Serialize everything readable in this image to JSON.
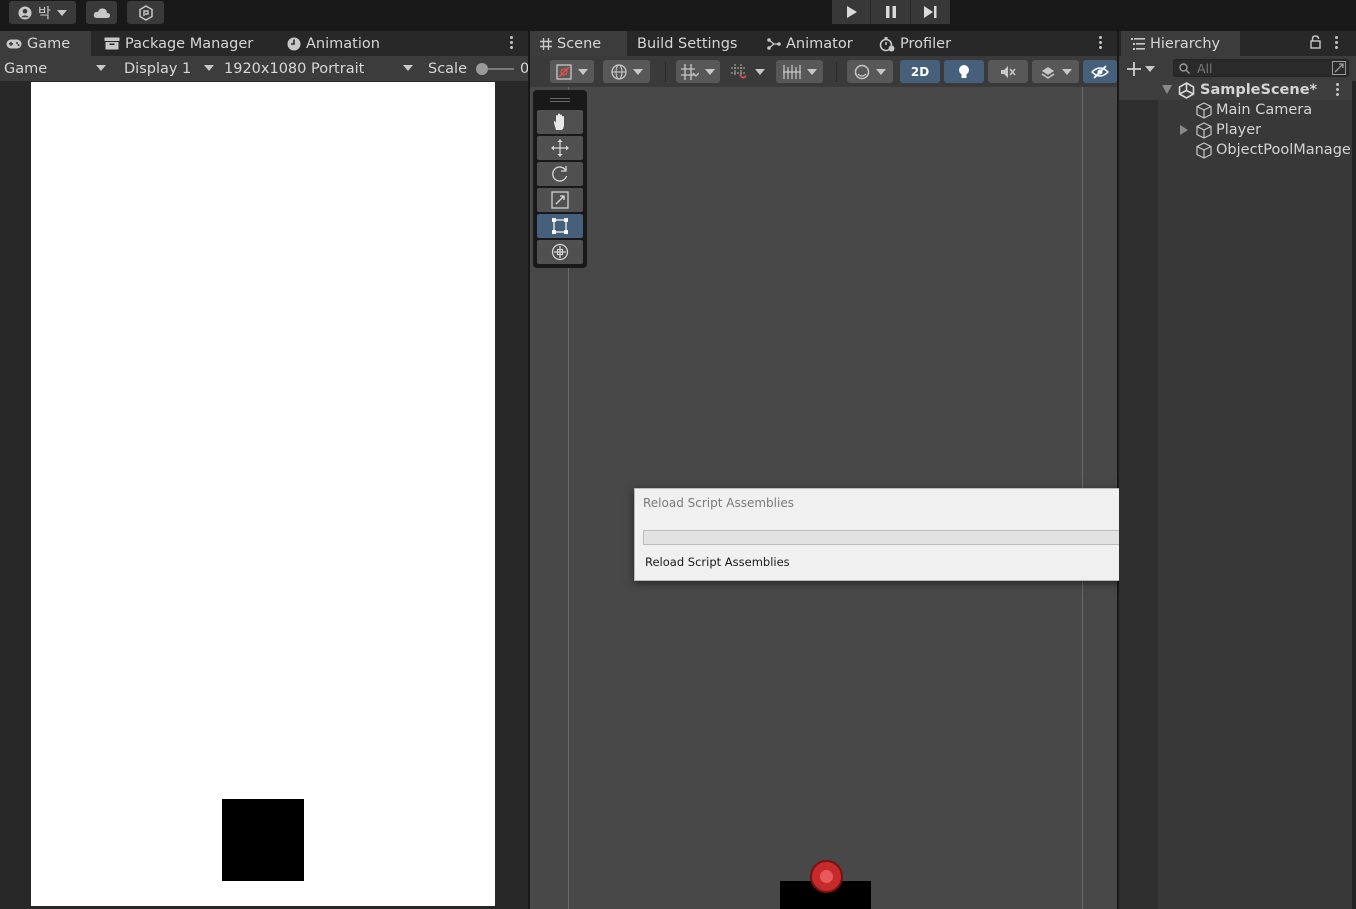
{
  "topbar": {
    "account_label": "박",
    "account_icon": "user-circle-icon",
    "cloud_icon": "cloud-icon",
    "collab_icon": "collab-icon",
    "play_icon": "play-icon",
    "pause_icon": "pause-icon",
    "step_icon": "step-icon"
  },
  "left_tabs": {
    "game": "Game",
    "package_manager": "Package Manager",
    "animation": "Animation"
  },
  "game_toolbar": {
    "view_mode": "Game",
    "display": "Display 1",
    "resolution": "1920x1080 Portrait",
    "scale_label": "Scale",
    "scale_value": "0"
  },
  "center_tabs": {
    "scene": "Scene",
    "build_settings": "Build Settings",
    "animator": "Animator",
    "profiler": "Profiler"
  },
  "scene_toolbar": {
    "mode_2d": "2D"
  },
  "tools": [
    "hand-icon",
    "move-icon",
    "rotate-icon",
    "scale-icon",
    "rect-tool-icon",
    "transform-icon"
  ],
  "dialog": {
    "title": "Reload Script Assemblies",
    "status": "Reload Script Assemblies",
    "progress": 0
  },
  "hierarchy": {
    "tab": "Hierarchy",
    "search_placeholder": "All",
    "scene_name": "SampleScene*",
    "items": [
      {
        "label": "Main Camera",
        "expandable": false
      },
      {
        "label": "Player",
        "expandable": true
      },
      {
        "label": "ObjectPoolManager",
        "expandable": false
      }
    ]
  },
  "colors": {
    "accent_blue": "#46607c",
    "player_red": "#c62a2a"
  }
}
